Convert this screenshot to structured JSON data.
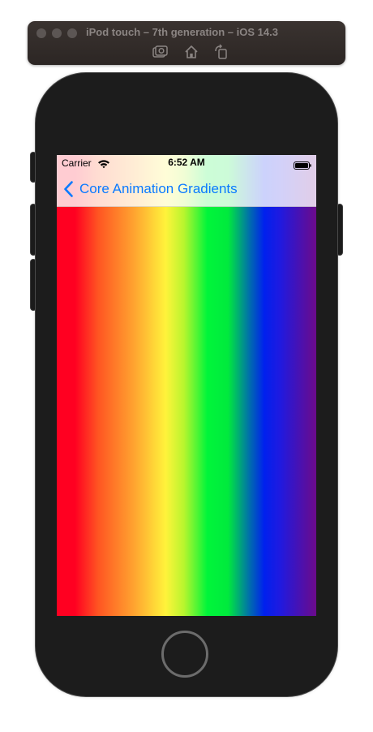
{
  "simulator": {
    "title": "iPod touch – 7th generation – iOS 14.3",
    "toolbar": [
      "screenshot-icon",
      "home-icon",
      "rotate-icon"
    ]
  },
  "status_bar": {
    "carrier": "Carrier",
    "time": "6:52 AM",
    "wifi_icon": "wifi-icon",
    "battery_icon": "battery-icon"
  },
  "nav_bar": {
    "back_label": "Core Animation Gradients",
    "back_icon": "chevron-left-icon",
    "tint_color": "#0a7aff"
  },
  "gradient": {
    "direction": "horizontal",
    "colors": [
      "#ff0021",
      "#ff5522",
      "#ffa530",
      "#fff33b",
      "#00f53a",
      "#0020ee",
      "#6c0a8a"
    ]
  },
  "device": {
    "home_button": "home-button"
  }
}
